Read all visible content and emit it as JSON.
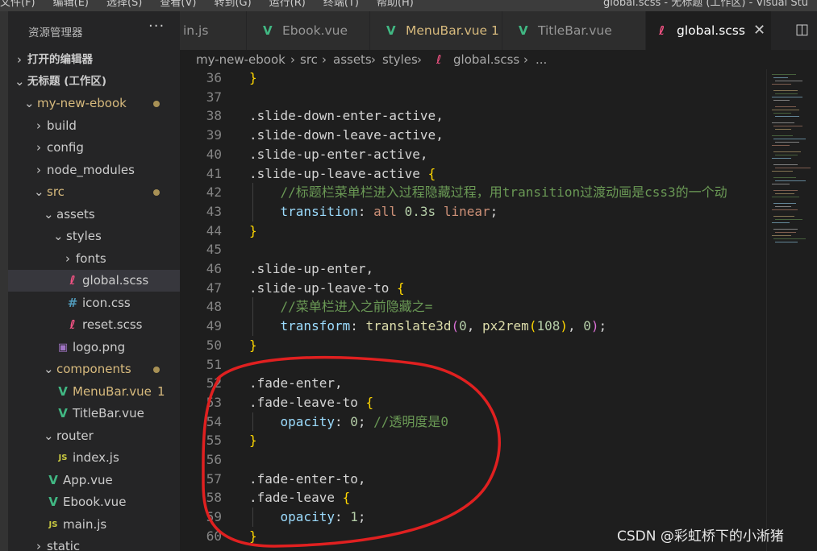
{
  "menu": {
    "items": [
      "文件(F)",
      "编辑(E)",
      "选择(S)",
      "查看(V)",
      "转到(G)",
      "运行(R)",
      "终端(T)",
      "帮助(H)"
    ],
    "window_title": "global.scss - 无标题 (工作区) - Visual Stu"
  },
  "sidebar": {
    "header": "资源管理器",
    "more": "···",
    "rows": [
      {
        "label": "打开的编辑器",
        "chevron": "›"
      },
      {
        "label": "无标题 (工作区)",
        "chevron": "⌄"
      },
      {
        "label": "my-new-ebook",
        "chevron": "⌄"
      },
      {
        "label": "build",
        "chevron": "›"
      },
      {
        "label": "config",
        "chevron": "›"
      },
      {
        "label": "node_modules",
        "chevron": "›"
      },
      {
        "label": "src",
        "chevron": "⌄"
      },
      {
        "label": "assets",
        "chevron": "⌄"
      },
      {
        "label": "styles",
        "chevron": "⌄"
      },
      {
        "label": "fonts",
        "chevron": "›"
      },
      {
        "label": "global.scss",
        "icon": "scss-icon",
        "glyph": "ℓ"
      },
      {
        "label": "icon.css",
        "icon": "css-icon",
        "glyph": "#"
      },
      {
        "label": "reset.scss",
        "icon": "scss-icon",
        "glyph": "ℓ"
      },
      {
        "label": "logo.png",
        "icon": "image-icon",
        "glyph": "▣"
      },
      {
        "label": "components",
        "chevron": "⌄"
      },
      {
        "label": "MenuBar.vue",
        "icon": "vue-icon",
        "glyph": "V",
        "badge": "1"
      },
      {
        "label": "TitleBar.vue",
        "icon": "vue-icon",
        "glyph": "V"
      },
      {
        "label": "router",
        "chevron": "⌄"
      },
      {
        "label": "index.js",
        "icon": "js-icon",
        "glyph": "JS"
      },
      {
        "label": "App.vue",
        "icon": "vue-icon",
        "glyph": "V"
      },
      {
        "label": "Ebook.vue",
        "icon": "vue-icon",
        "glyph": "V"
      },
      {
        "label": "main.js",
        "icon": "js-icon",
        "glyph": "JS"
      },
      {
        "label": "static",
        "chevron": "›"
      }
    ]
  },
  "tabs": [
    {
      "label": "in.js",
      "active": false
    },
    {
      "label": "Ebook.vue",
      "icon": "vue-icon",
      "glyph": "V",
      "active": false
    },
    {
      "label": "MenuBar.vue 1",
      "icon": "vue-icon",
      "glyph": "V",
      "active": false
    },
    {
      "label": "TitleBar.vue",
      "icon": "vue-icon",
      "glyph": "V",
      "active": false
    },
    {
      "label": "global.scss",
      "icon": "scss-icon",
      "glyph": "ℓ",
      "active": true,
      "close": "✕"
    }
  ],
  "split_icon": "split-editor-icon",
  "split_glyph": "◫",
  "breadcrumb": [
    "my-new-ebook",
    "›",
    "src",
    "›",
    "assets",
    "›",
    "styles",
    "›",
    "ℓ",
    "global.scss",
    "›",
    "..."
  ],
  "editor": {
    "lines": [
      {
        "n": "36",
        "tokens": [
          {
            "t": "}",
            "c": "c-br1"
          }
        ]
      },
      {
        "n": "37",
        "tokens": []
      },
      {
        "n": "38",
        "tokens": [
          {
            "t": ".slide-down-enter-active,",
            "c": "c-plain"
          }
        ]
      },
      {
        "n": "39",
        "tokens": [
          {
            "t": ".slide-down-leave-active,",
            "c": "c-plain"
          }
        ]
      },
      {
        "n": "40",
        "tokens": [
          {
            "t": ".slide-up-enter-active,",
            "c": "c-plain"
          }
        ]
      },
      {
        "n": "41",
        "tokens": [
          {
            "t": ".slide-up-leave-active ",
            "c": "c-plain"
          },
          {
            "t": "{",
            "c": "c-br1"
          }
        ]
      },
      {
        "n": "42",
        "guide": true,
        "tokens": [
          {
            "t": "    //标题栏菜单栏进入过程隐藏过程，用transition过渡动画是css3的一个动",
            "c": "c-com"
          }
        ]
      },
      {
        "n": "43",
        "guide": true,
        "tokens": [
          {
            "t": "    transition",
            "c": "c-prop"
          },
          {
            "t": ": ",
            "c": "c-plain"
          },
          {
            "t": "all ",
            "c": "c-val"
          },
          {
            "t": "0.3s ",
            "c": "c-num"
          },
          {
            "t": "linear",
            "c": "c-val"
          },
          {
            "t": ";",
            "c": "c-plain"
          }
        ]
      },
      {
        "n": "44",
        "tokens": [
          {
            "t": "}",
            "c": "c-br1"
          }
        ]
      },
      {
        "n": "45",
        "tokens": []
      },
      {
        "n": "46",
        "tokens": [
          {
            "t": ".slide-up-enter,",
            "c": "c-plain"
          }
        ]
      },
      {
        "n": "47",
        "tokens": [
          {
            "t": ".slide-up-leave-to ",
            "c": "c-plain"
          },
          {
            "t": "{",
            "c": "c-br1"
          }
        ]
      },
      {
        "n": "48",
        "guide": true,
        "tokens": [
          {
            "t": "    //菜单栏进入之前隐藏之=",
            "c": "c-com"
          }
        ]
      },
      {
        "n": "49",
        "guide": true,
        "tokens": [
          {
            "t": "    transform",
            "c": "c-prop"
          },
          {
            "t": ": ",
            "c": "c-plain"
          },
          {
            "t": "translate3d",
            "c": "c-fn"
          },
          {
            "t": "(",
            "c": "c-br2"
          },
          {
            "t": "0",
            "c": "c-num"
          },
          {
            "t": ", ",
            "c": "c-plain"
          },
          {
            "t": "px2rem",
            "c": "c-fn"
          },
          {
            "t": "(",
            "c": "c-br1"
          },
          {
            "t": "108",
            "c": "c-num"
          },
          {
            "t": ")",
            "c": "c-br1"
          },
          {
            "t": ", ",
            "c": "c-plain"
          },
          {
            "t": "0",
            "c": "c-num"
          },
          {
            "t": ")",
            "c": "c-br2"
          },
          {
            "t": ";",
            "c": "c-plain"
          }
        ]
      },
      {
        "n": "50",
        "tokens": [
          {
            "t": "}",
            "c": "c-br1"
          }
        ]
      },
      {
        "n": "51",
        "tokens": []
      },
      {
        "n": "52",
        "tokens": [
          {
            "t": ".fade-enter,",
            "c": "c-plain"
          }
        ]
      },
      {
        "n": "53",
        "tokens": [
          {
            "t": ".fade-leave-to ",
            "c": "c-plain"
          },
          {
            "t": "{",
            "c": "c-br1"
          }
        ]
      },
      {
        "n": "54",
        "guide": true,
        "tokens": [
          {
            "t": "    opacity",
            "c": "c-prop"
          },
          {
            "t": ": ",
            "c": "c-plain"
          },
          {
            "t": "0",
            "c": "c-num"
          },
          {
            "t": "; ",
            "c": "c-plain"
          },
          {
            "t": "//透明度是0",
            "c": "c-com"
          }
        ]
      },
      {
        "n": "55",
        "tokens": [
          {
            "t": "}",
            "c": "c-br1"
          }
        ]
      },
      {
        "n": "56",
        "tokens": []
      },
      {
        "n": "57",
        "tokens": [
          {
            "t": ".fade-enter-to,",
            "c": "c-plain"
          }
        ]
      },
      {
        "n": "58",
        "tokens": [
          {
            "t": ".fade-leave ",
            "c": "c-plain"
          },
          {
            "t": "{",
            "c": "c-br1"
          }
        ]
      },
      {
        "n": "59",
        "guide": true,
        "tokens": [
          {
            "t": "    opacity",
            "c": "c-prop"
          },
          {
            "t": ": ",
            "c": "c-plain"
          },
          {
            "t": "1",
            "c": "c-num"
          },
          {
            "t": ";",
            "c": "c-plain"
          }
        ]
      },
      {
        "n": "60",
        "tokens": [
          {
            "t": "}",
            "c": "c-br1"
          }
        ]
      }
    ]
  },
  "watermark": "CSDN @彩虹桥下的小淅猪",
  "colors": {
    "annotation_circle": "#e02020",
    "selected_row": "#37373d",
    "modified_dot": "#a89155"
  }
}
